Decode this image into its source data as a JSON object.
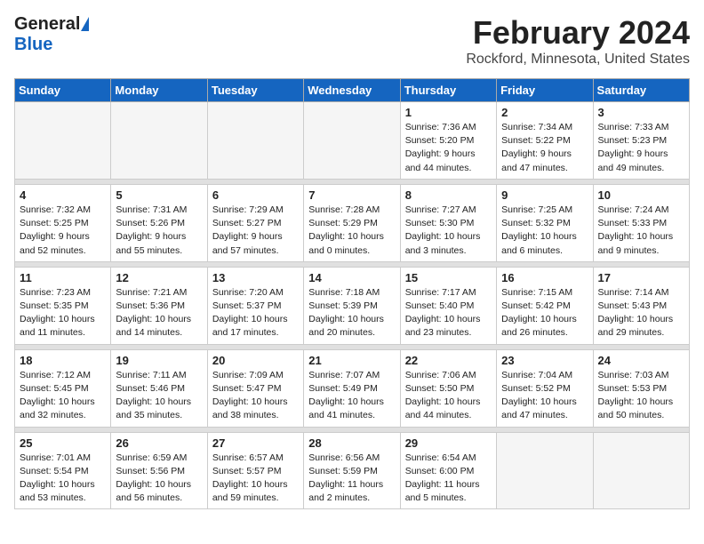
{
  "header": {
    "logo_general": "General",
    "logo_blue": "Blue",
    "title": "February 2024",
    "location": "Rockford, Minnesota, United States"
  },
  "weekdays": [
    "Sunday",
    "Monday",
    "Tuesday",
    "Wednesday",
    "Thursday",
    "Friday",
    "Saturday"
  ],
  "weeks": [
    [
      {
        "day": "",
        "empty": true
      },
      {
        "day": "",
        "empty": true
      },
      {
        "day": "",
        "empty": true
      },
      {
        "day": "",
        "empty": true
      },
      {
        "day": "1",
        "sunrise": "7:36 AM",
        "sunset": "5:20 PM",
        "daylight": "9 hours and 44 minutes."
      },
      {
        "day": "2",
        "sunrise": "7:34 AM",
        "sunset": "5:22 PM",
        "daylight": "9 hours and 47 minutes."
      },
      {
        "day": "3",
        "sunrise": "7:33 AM",
        "sunset": "5:23 PM",
        "daylight": "9 hours and 49 minutes."
      }
    ],
    [
      {
        "day": "4",
        "sunrise": "7:32 AM",
        "sunset": "5:25 PM",
        "daylight": "9 hours and 52 minutes."
      },
      {
        "day": "5",
        "sunrise": "7:31 AM",
        "sunset": "5:26 PM",
        "daylight": "9 hours and 55 minutes."
      },
      {
        "day": "6",
        "sunrise": "7:29 AM",
        "sunset": "5:27 PM",
        "daylight": "9 hours and 57 minutes."
      },
      {
        "day": "7",
        "sunrise": "7:28 AM",
        "sunset": "5:29 PM",
        "daylight": "10 hours and 0 minutes."
      },
      {
        "day": "8",
        "sunrise": "7:27 AM",
        "sunset": "5:30 PM",
        "daylight": "10 hours and 3 minutes."
      },
      {
        "day": "9",
        "sunrise": "7:25 AM",
        "sunset": "5:32 PM",
        "daylight": "10 hours and 6 minutes."
      },
      {
        "day": "10",
        "sunrise": "7:24 AM",
        "sunset": "5:33 PM",
        "daylight": "10 hours and 9 minutes."
      }
    ],
    [
      {
        "day": "11",
        "sunrise": "7:23 AM",
        "sunset": "5:35 PM",
        "daylight": "10 hours and 11 minutes."
      },
      {
        "day": "12",
        "sunrise": "7:21 AM",
        "sunset": "5:36 PM",
        "daylight": "10 hours and 14 minutes."
      },
      {
        "day": "13",
        "sunrise": "7:20 AM",
        "sunset": "5:37 PM",
        "daylight": "10 hours and 17 minutes."
      },
      {
        "day": "14",
        "sunrise": "7:18 AM",
        "sunset": "5:39 PM",
        "daylight": "10 hours and 20 minutes."
      },
      {
        "day": "15",
        "sunrise": "7:17 AM",
        "sunset": "5:40 PM",
        "daylight": "10 hours and 23 minutes."
      },
      {
        "day": "16",
        "sunrise": "7:15 AM",
        "sunset": "5:42 PM",
        "daylight": "10 hours and 26 minutes."
      },
      {
        "day": "17",
        "sunrise": "7:14 AM",
        "sunset": "5:43 PM",
        "daylight": "10 hours and 29 minutes."
      }
    ],
    [
      {
        "day": "18",
        "sunrise": "7:12 AM",
        "sunset": "5:45 PM",
        "daylight": "10 hours and 32 minutes."
      },
      {
        "day": "19",
        "sunrise": "7:11 AM",
        "sunset": "5:46 PM",
        "daylight": "10 hours and 35 minutes."
      },
      {
        "day": "20",
        "sunrise": "7:09 AM",
        "sunset": "5:47 PM",
        "daylight": "10 hours and 38 minutes."
      },
      {
        "day": "21",
        "sunrise": "7:07 AM",
        "sunset": "5:49 PM",
        "daylight": "10 hours and 41 minutes."
      },
      {
        "day": "22",
        "sunrise": "7:06 AM",
        "sunset": "5:50 PM",
        "daylight": "10 hours and 44 minutes."
      },
      {
        "day": "23",
        "sunrise": "7:04 AM",
        "sunset": "5:52 PM",
        "daylight": "10 hours and 47 minutes."
      },
      {
        "day": "24",
        "sunrise": "7:03 AM",
        "sunset": "5:53 PM",
        "daylight": "10 hours and 50 minutes."
      }
    ],
    [
      {
        "day": "25",
        "sunrise": "7:01 AM",
        "sunset": "5:54 PM",
        "daylight": "10 hours and 53 minutes."
      },
      {
        "day": "26",
        "sunrise": "6:59 AM",
        "sunset": "5:56 PM",
        "daylight": "10 hours and 56 minutes."
      },
      {
        "day": "27",
        "sunrise": "6:57 AM",
        "sunset": "5:57 PM",
        "daylight": "10 hours and 59 minutes."
      },
      {
        "day": "28",
        "sunrise": "6:56 AM",
        "sunset": "5:59 PM",
        "daylight": "11 hours and 2 minutes."
      },
      {
        "day": "29",
        "sunrise": "6:54 AM",
        "sunset": "6:00 PM",
        "daylight": "11 hours and 5 minutes."
      },
      {
        "day": "",
        "empty": true
      },
      {
        "day": "",
        "empty": true
      }
    ]
  ]
}
